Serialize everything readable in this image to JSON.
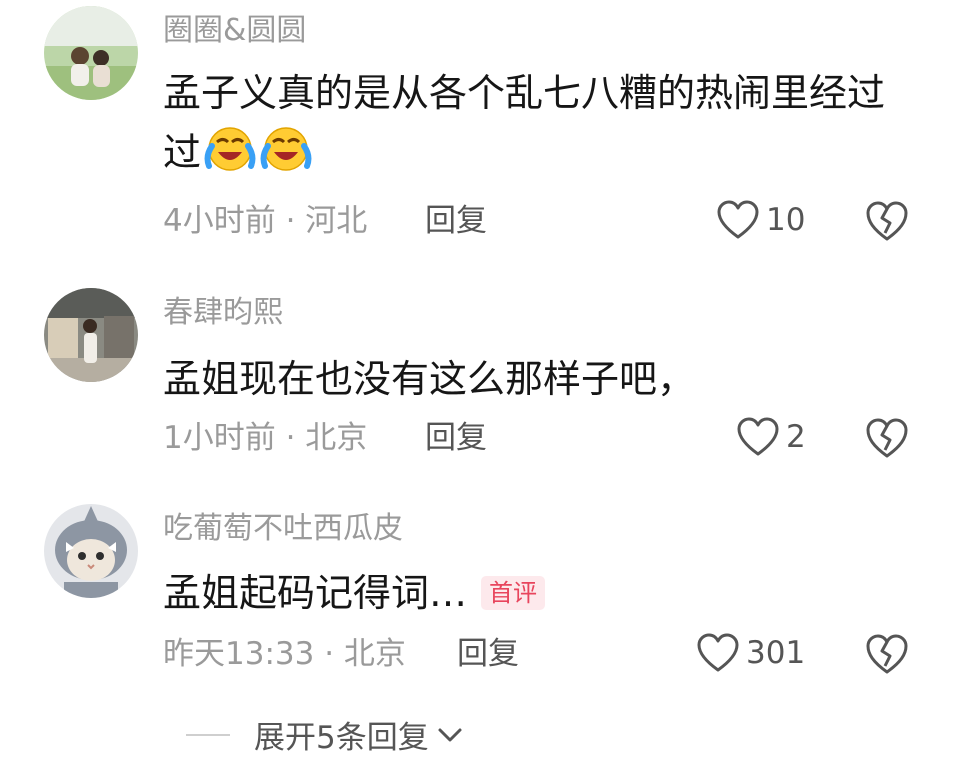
{
  "comments": [
    {
      "username": "圈圈&圆圆",
      "content": "孟子义真的是从各个乱七八糟的热闹里经过",
      "emoji_icons": [
        "laughing-crying-emoji",
        "laughing-crying-emoji"
      ],
      "time": "4小时前",
      "location": "河北",
      "reply_label": "回复",
      "likes": "10",
      "badge": ""
    },
    {
      "username": "春肆昀熙",
      "content": "孟姐现在也没有这么那样子吧，",
      "emoji_icons": [],
      "time": "1小时前",
      "location": "北京",
      "reply_label": "回复",
      "likes": "2",
      "badge": ""
    },
    {
      "username": "吃葡萄不吐西瓜皮",
      "content": "孟姐起码记得词…",
      "emoji_icons": [],
      "time": "昨天13:33",
      "location": "北京",
      "reply_label": "回复",
      "likes": "301",
      "badge": "首评"
    }
  ],
  "meta_separator": " · ",
  "expand_replies": {
    "label": "展开5条回复",
    "icon": "chevron-down-icon"
  },
  "icons": {
    "like": "heart-outline-icon",
    "dislike": "broken-heart-icon"
  },
  "colors": {
    "username": "#9a9a9a",
    "text": "#161616",
    "meta": "#9a9a9a",
    "badge_text": "#e8455d",
    "badge_bg": "#fde9ec"
  }
}
